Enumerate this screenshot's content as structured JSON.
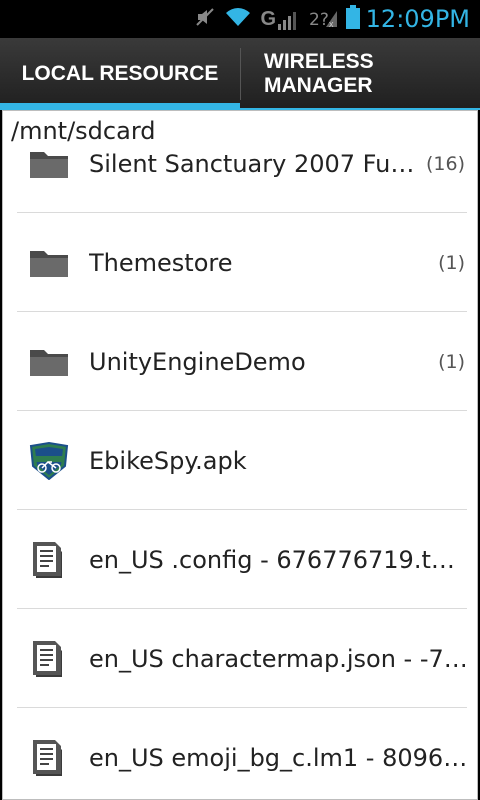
{
  "status_bar": {
    "time": "12:09PM",
    "icons": [
      "mute-icon",
      "wifi-icon",
      "gsm-signal-icon",
      "sim2-no-signal-icon",
      "battery-icon"
    ],
    "network_label": "G"
  },
  "tabs": [
    {
      "label": "LOCAL RESOURCE",
      "active": true
    },
    {
      "label": "WIRELESS\nMANAGER",
      "active": false
    }
  ],
  "accent_color": "#33b5e5",
  "path": "/mnt/sdcard",
  "items": [
    {
      "type": "folder",
      "icon": "folder-icon",
      "name": "Silent Sanctuary 2007 Fus…",
      "count": "(16)"
    },
    {
      "type": "folder",
      "icon": "folder-icon",
      "name": "Themestore",
      "count": "(1)"
    },
    {
      "type": "folder",
      "icon": "folder-icon",
      "name": "UnityEngineDemo",
      "count": "(1)"
    },
    {
      "type": "apk",
      "icon": "ebikespy-app-icon",
      "name": "EbikeSpy.apk",
      "count": ""
    },
    {
      "type": "file",
      "icon": "document-icon",
      "name": "en_US .config - 676776719.tmp",
      "count": ""
    },
    {
      "type": "file",
      "icon": "document-icon",
      "name": "en_US charactermap.json - -7…",
      "count": ""
    },
    {
      "type": "file",
      "icon": "document-icon",
      "name": "en_US emoji_bg_c.lm1 - 80967…",
      "count": ""
    }
  ]
}
